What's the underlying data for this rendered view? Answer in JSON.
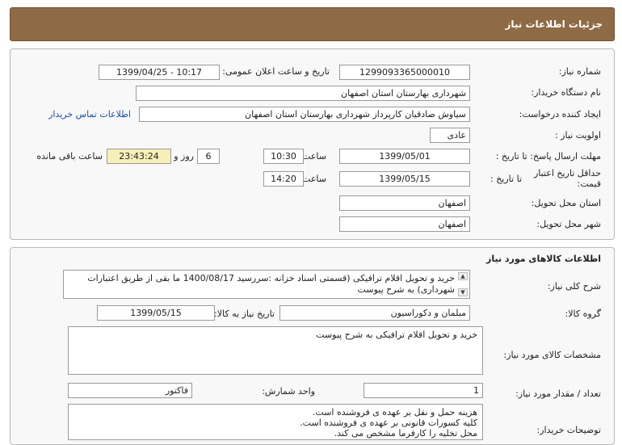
{
  "header": {
    "title": "جزئیات اطلاعات نیاز"
  },
  "fields": {
    "need_number_label": "شماره نیاز:",
    "need_number": "1299093365000010",
    "announce_label": "تاریخ و ساعت اعلان عمومی:",
    "announce_value": "1399/04/25 - 10:17",
    "buyer_org_label": "نام دستگاه خریدار:",
    "buyer_org": "شهرداری بهارستان استان اصفهان",
    "requester_label": "ایجاد کننده درخواست:",
    "requester": "سیاوش صادقیان کارپرداز شهرداری بهارستان استان اصفهان",
    "contact_link": "اطلاعات تماس خریدار",
    "priority_label": "اولویت نیاز :",
    "priority": "عادی",
    "deadline_label": "مهلت ارسال پاسخ: تا تاریخ :",
    "deadline_date": "1399/05/01",
    "time_label": "ساعت",
    "deadline_time": "10:30",
    "days_value": "6",
    "days_label": "روز و",
    "remaining_time": "23:43:24",
    "remaining_label": "ساعت باقی مانده",
    "validity_label": "حداقل تاریخ اعتبار قیمت:",
    "until_date_label": "تا تاریخ :",
    "validity_date": "1399/05/15",
    "validity_time": "14:20",
    "province_label": "استان محل تحویل:",
    "province": "اصفهان",
    "city_label": "شهر محل تحویل:",
    "city": "اصفهان"
  },
  "goods": {
    "section_title": "اطلاعات کالاهای مورد نیاز",
    "desc_label": "شرح کلی نیاز:",
    "desc": "خرید و تحویل اقلام ترافیکی (قسمتی اسناد خزانه :سررسید 1400/08/17 ما بقی از طریق اعتبارات شهرداری) به شرح پیوست",
    "group_label": "گروه کالا:",
    "group": "مبلمان و دکوراسیون",
    "need_date_label": "تاریخ نیاز به کالا:",
    "need_date": "1399/05/15",
    "specs_label": "مشخصات کالای مورد نیاز:",
    "specs": "خرید و تحویل اقلام ترافیکی به شرح پیوست",
    "qty_label": "تعداد / مقدار مورد نیاز:",
    "qty": "1",
    "unit_label": "واحد شمارش:",
    "unit": "فاکتور",
    "notes_label": "توضیحات خریدار:",
    "notes": [
      "هزینه حمل و نقل بر عهده ی فروشنده است.",
      "کلیه کسورات قانونی بر عهده ی فروشنده است.",
      "محل تخلیه را کارفرما مشخص می کند."
    ]
  },
  "icons": {
    "scroll_up": "▲",
    "scroll_down": "▼"
  }
}
